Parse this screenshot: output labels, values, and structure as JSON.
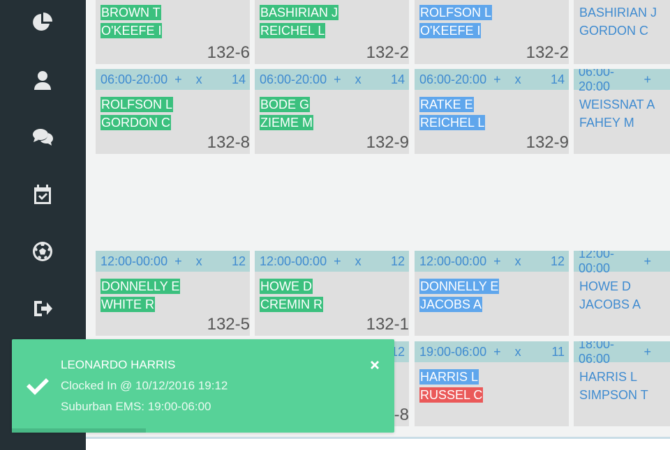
{
  "sidebar": {
    "items": [
      {
        "icon": "pie-chart-icon"
      },
      {
        "icon": "user-icon"
      },
      {
        "icon": "chat-icon"
      },
      {
        "icon": "calendar-check-icon"
      },
      {
        "icon": "soccer-ball-icon"
      },
      {
        "icon": "sign-out-icon"
      }
    ]
  },
  "cards": {
    "r1c1": {
      "names": [
        "BROWN T",
        "O'KEEFE I"
      ],
      "room": "132-6"
    },
    "r1c2": {
      "names": [
        "BASHIRIAN J",
        "REICHEL L"
      ],
      "room": "132-2"
    },
    "r1c3": {
      "names": [
        "ROLFSON L",
        "O'KEEFE I"
      ],
      "room": "132-2"
    },
    "r1c4": {
      "names": [
        "BASHIRIAN J",
        "GORDON C"
      ]
    },
    "r2c1": {
      "time": "06:00-20:00",
      "plus": "+",
      "x": "x",
      "count": "14",
      "names": [
        "ROLFSON L",
        "GORDON C"
      ],
      "room": "132-8"
    },
    "r2c2": {
      "time": "06:00-20:00",
      "plus": "+",
      "x": "x",
      "count": "14",
      "names": [
        "BODE G",
        "ZIEME M"
      ],
      "room": "132-9"
    },
    "r2c3": {
      "time": "06:00-20:00",
      "plus": "+",
      "x": "x",
      "count": "14",
      "names": [
        "RATKE E",
        "REICHEL L"
      ],
      "room": "132-9"
    },
    "r2c4": {
      "time": "06:00-20:00",
      "plus": "+",
      "names": [
        "WEISSNAT A",
        "FAHEY M"
      ]
    },
    "r3c1": {
      "time": "12:00-00:00",
      "plus": "+",
      "x": "x",
      "count": "12",
      "names": [
        "DONNELLY E",
        "WHITE R"
      ],
      "room": "132-5"
    },
    "r3c2": {
      "time": "12:00-00:00",
      "plus": "+",
      "x": "x",
      "count": "12",
      "names": [
        "HOWE D",
        "CREMIN R"
      ],
      "room": "132-1"
    },
    "r3c3": {
      "time": "12:00-00:00",
      "plus": "+",
      "x": "x",
      "count": "12",
      "names": [
        "DONNELLY E",
        "JACOBS A"
      ]
    },
    "r3c4": {
      "time": "12:00-00:00",
      "plus": "+",
      "names": [
        "HOWE D",
        "JACOBS A"
      ]
    },
    "r4c2": {
      "count": "12",
      "room": "-8"
    },
    "r4c3": {
      "time": "19:00-06:00",
      "plus": "+",
      "x": "x",
      "count": "11",
      "names": [
        "HARRIS L",
        "RUSSEL C"
      ]
    },
    "r4c4": {
      "time": "18:00-06:00",
      "plus": "+",
      "names": [
        "HARRIS L",
        "SIMPSON T"
      ]
    }
  },
  "colors": {
    "sidebar": "#253036",
    "card_header": "#b2d6d6",
    "highlight_green": "#3bc07e",
    "highlight_blue": "#5fa6ec",
    "highlight_red": "#ea5959",
    "toast": "#57d298"
  },
  "toast": {
    "title": "LEONARDO HARRIS",
    "line1": "Clocked In @ 10/12/2016 19:12",
    "line2": "Suburban EMS: 19:00-06:00",
    "close_icon": "close-icon",
    "check_icon": "check-icon",
    "progress_percent": 35
  }
}
